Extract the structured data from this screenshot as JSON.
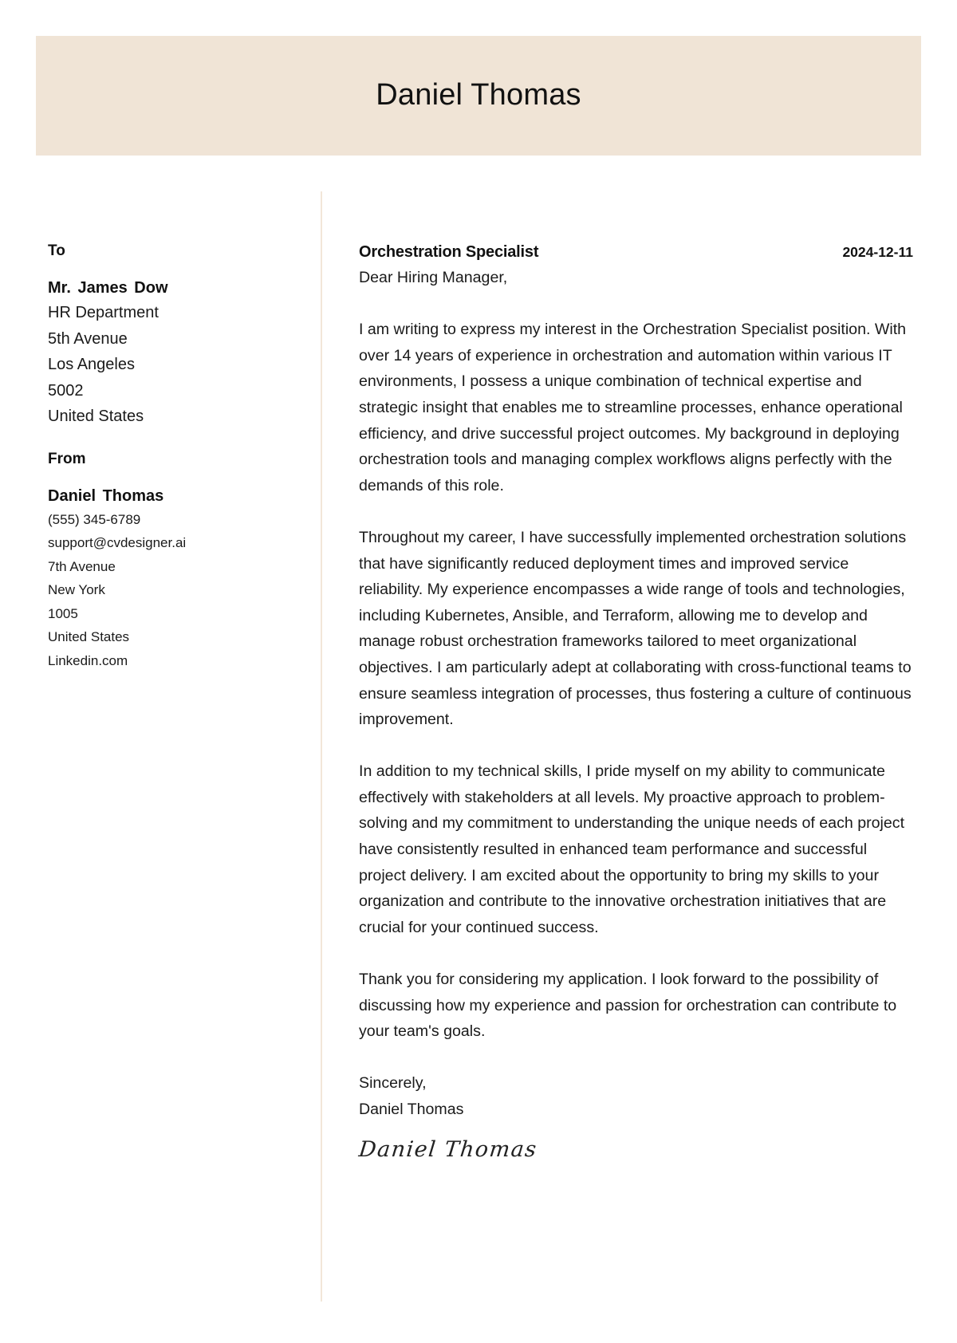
{
  "header": {
    "name": "Daniel Thomas",
    "band_color": "#f0e4d6"
  },
  "recipient": {
    "label": "To",
    "name": "Mr. James Dow",
    "lines": [
      "HR Department",
      "5th Avenue",
      "Los Angeles",
      "5002",
      "United States"
    ]
  },
  "sender": {
    "label": "From",
    "name": "Daniel Thomas",
    "lines": [
      "(555) 345-6789",
      "support@cvdesigner.ai",
      "7th Avenue",
      "New York",
      "1005",
      "United States",
      "Linkedin.com"
    ]
  },
  "letter": {
    "job_title": "Orchestration Specialist",
    "date": "2024-12-11",
    "salutation": "Dear Hiring Manager,",
    "paragraphs": [
      "I am writing to express my interest in the Orchestration Specialist position. With over 14 years of experience in orchestration and automation within various IT environments, I possess a unique combination of technical expertise and strategic insight that enables me to streamline processes, enhance operational efficiency, and drive successful project outcomes. My background in deploying orchestration tools and managing complex workflows aligns perfectly with the demands of this role.",
      "Throughout my career, I have successfully implemented orchestration solutions that have significantly reduced deployment times and improved service reliability. My experience encompasses a wide range of tools and technologies, including Kubernetes, Ansible, and Terraform, allowing me to develop and manage robust orchestration frameworks tailored to meet organizational objectives. I am particularly adept at collaborating with cross-functional teams to ensure seamless integration of processes, thus fostering a culture of continuous improvement.",
      "In addition to my technical skills, I pride myself on my ability to communicate effectively with stakeholders at all levels. My proactive approach to problem-solving and my commitment to understanding the unique needs of each project have consistently resulted in enhanced team performance and successful project delivery. I am excited about the opportunity to bring my skills to your organization and contribute to the innovative orchestration initiatives that are crucial for your continued success.",
      "Thank you for considering my application. I look forward to the possibility of discussing how my experience and passion for orchestration can contribute to your team's goals."
    ],
    "closing": "Sincerely,",
    "closing_name": "Daniel Thomas",
    "signature": "Daniel Thomas"
  }
}
